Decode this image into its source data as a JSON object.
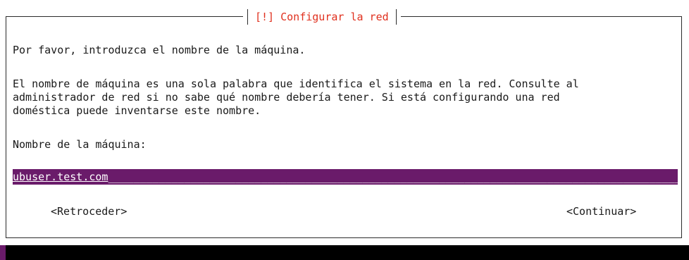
{
  "dialog": {
    "title": "[!] Configurar la red"
  },
  "content": {
    "prompt": "Por favor, introduzca el nombre de la máquina.",
    "description_lines": [
      "El nombre de máquina es una sola palabra que identifica el sistema en la red. Consulte al",
      "administrador de red si no sabe qué nombre debería tener. Si está configurando una red",
      "doméstica puede inventarse este nombre."
    ],
    "field_label": "Nombre de la máquina:"
  },
  "hostname_input": {
    "value": "ubuser.test.com"
  },
  "buttons": {
    "back": "<Retroceder>",
    "continue": "<Continuar>"
  },
  "colors": {
    "title": "#e0301e",
    "field_background": "#6a1b6a",
    "bottom_bar": "#000000"
  }
}
